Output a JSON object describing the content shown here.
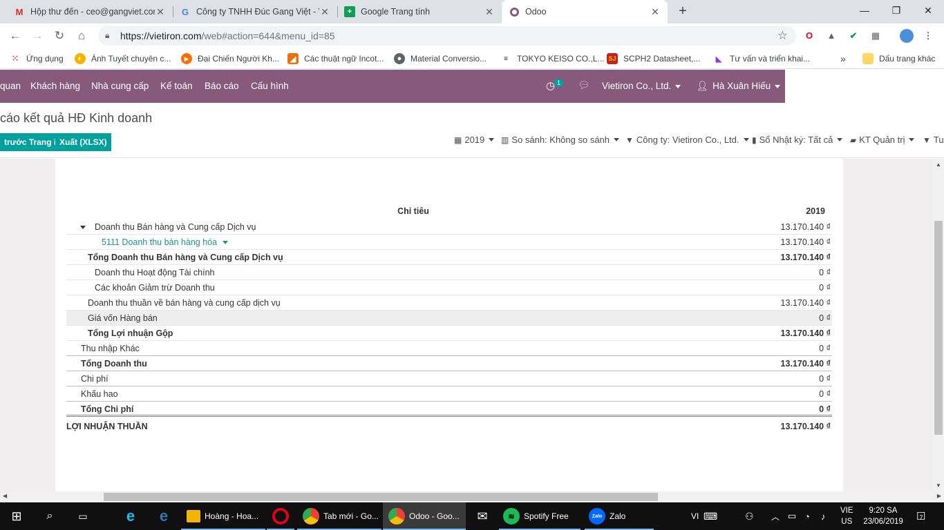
{
  "browser": {
    "tabs": [
      {
        "title": "Hộp thư đến - ceo@gangviet.com",
        "icon": "gmail-icon",
        "color": "#d93025",
        "glyph": "M"
      },
      {
        "title": "Công ty TNHH Đúc Gang Việt - V",
        "icon": "google-icon",
        "color": "#4285f4",
        "glyph": "G"
      },
      {
        "title": "Google Trang tính",
        "icon": "sheets-icon",
        "color": "#0f9d58",
        "glyph": "+"
      },
      {
        "title": "Odoo",
        "icon": "odoo-icon",
        "color": "#875a7b",
        "glyph": "O"
      }
    ],
    "url_host": "https://vietiron.com",
    "url_path": "/web#action=644&menu_id=85",
    "bookmarks": [
      {
        "label": "Ứng dụng",
        "icon": "apps-grid-icon",
        "color": "#e94235"
      },
      {
        "label": "Ánh Tuyết chuyên c...",
        "icon": "site-globe-icon",
        "color": "#f4b400"
      },
      {
        "label": "Đại Chiến Người Kh...",
        "icon": "play-icon",
        "color": "#ff6d00"
      },
      {
        "label": "Các thuật ngữ Incot...",
        "icon": "bookmark-flag-icon",
        "color": "#e8710a"
      },
      {
        "label": "Material Conversio...",
        "icon": "globe-icon",
        "color": "#5f6368"
      },
      {
        "label": "TOKYO KEISO CO.,L...",
        "icon": "tokyo-keiso-logo-icon",
        "color": "#202124"
      },
      {
        "label": "SCPH2 Datasheet,...",
        "icon": "sj-logo-icon",
        "color": "#c5221f"
      },
      {
        "label": "Tư vấn và triển khai...",
        "icon": "tv-logo-icon",
        "color": "#9334e6"
      }
    ],
    "more_bookmarks": "»",
    "other_bookmarks": "Dấu trang khác"
  },
  "odoo": {
    "menu": [
      "quan",
      "Khách hàng",
      "Nhà cung cấp",
      "Kế toán",
      "Báo cáo",
      "Cấu hình"
    ],
    "activity_count": "1",
    "company": "Vietiron Co., Ltd.",
    "user": "Hà Xuân Hiếu",
    "breadcrumb": "cáo kết quả HĐ Kinh doanh",
    "btn_print": "trước Trang in",
    "btn_export": "Xuất (XLSX)",
    "filters": {
      "year": "2019",
      "compare": "So sánh: Không so sánh",
      "company": "Công ty: Vietiron Co., Ltd.",
      "journal": "Sổ Nhật ký: Tất cả",
      "analytic": "KT Quản trị",
      "more": "Tuỳ"
    }
  },
  "report": {
    "col_label": "Chỉ tiêu",
    "col_year": "2019",
    "rows": [
      {
        "label": "Doanh thu Bán hàng và Cung cấp Dịch vụ",
        "value": "13.170.140 ₫"
      },
      {
        "label": "5111 Doanh thu bán hàng hóa",
        "value": "13.170.140 ₫"
      },
      {
        "label": "Tổng Doanh thu Bán hàng và Cung cấp Dịch vụ",
        "value": "13.170.140 ₫"
      },
      {
        "label": "Doanh thu Hoạt động Tài chính",
        "value": "0 ₫"
      },
      {
        "label": "Các khoản Giảm trừ Doanh thu",
        "value": "0 ₫"
      },
      {
        "label": "Doanh thu thuần về bán hàng và cung cấp dịch vụ",
        "value": "13.170.140 ₫"
      },
      {
        "label": "Giá vốn Hàng bán",
        "value": "0 ₫"
      },
      {
        "label": "Tổng Lợi nhuận Gộp",
        "value": "13.170.140 ₫"
      },
      {
        "label": "Thu nhập Khác",
        "value": "0 ₫"
      },
      {
        "label": "Tổng Doanh thu",
        "value": "13.170.140 ₫"
      },
      {
        "label": "Chi phí",
        "value": "0 ₫"
      },
      {
        "label": "Khấu hao",
        "value": "0 ₫"
      },
      {
        "label": "Tổng Chi phí",
        "value": "0 ₫"
      },
      {
        "label": "LỢI NHUẬN THUẦN",
        "value": "13.170.140 ₫"
      }
    ]
  },
  "taskbar": {
    "apps": [
      {
        "label": "Hoàng - Hoa...",
        "icon": "file-explorer-icon",
        "color": "#f4b400"
      },
      {
        "label": "",
        "icon": "opera-icon",
        "color": "#e2001a"
      },
      {
        "label": "Tab mới - Go...",
        "icon": "chrome-icon",
        "color": "#34a853"
      },
      {
        "label": "Odoo - Goo...",
        "icon": "chrome-icon",
        "color": "#34a853"
      },
      {
        "label": "",
        "icon": "mail-icon",
        "color": "#ffffff"
      },
      {
        "label": "Spotify Free",
        "icon": "spotify-icon",
        "color": "#1db954"
      },
      {
        "label": "Zalo",
        "icon": "zalo-icon",
        "color": "#0068ff"
      }
    ],
    "lang_input": "VI",
    "lang": "VIE",
    "region": "US",
    "time": "9:20 SA",
    "date": "23/06/2019",
    "notifications": "7"
  }
}
